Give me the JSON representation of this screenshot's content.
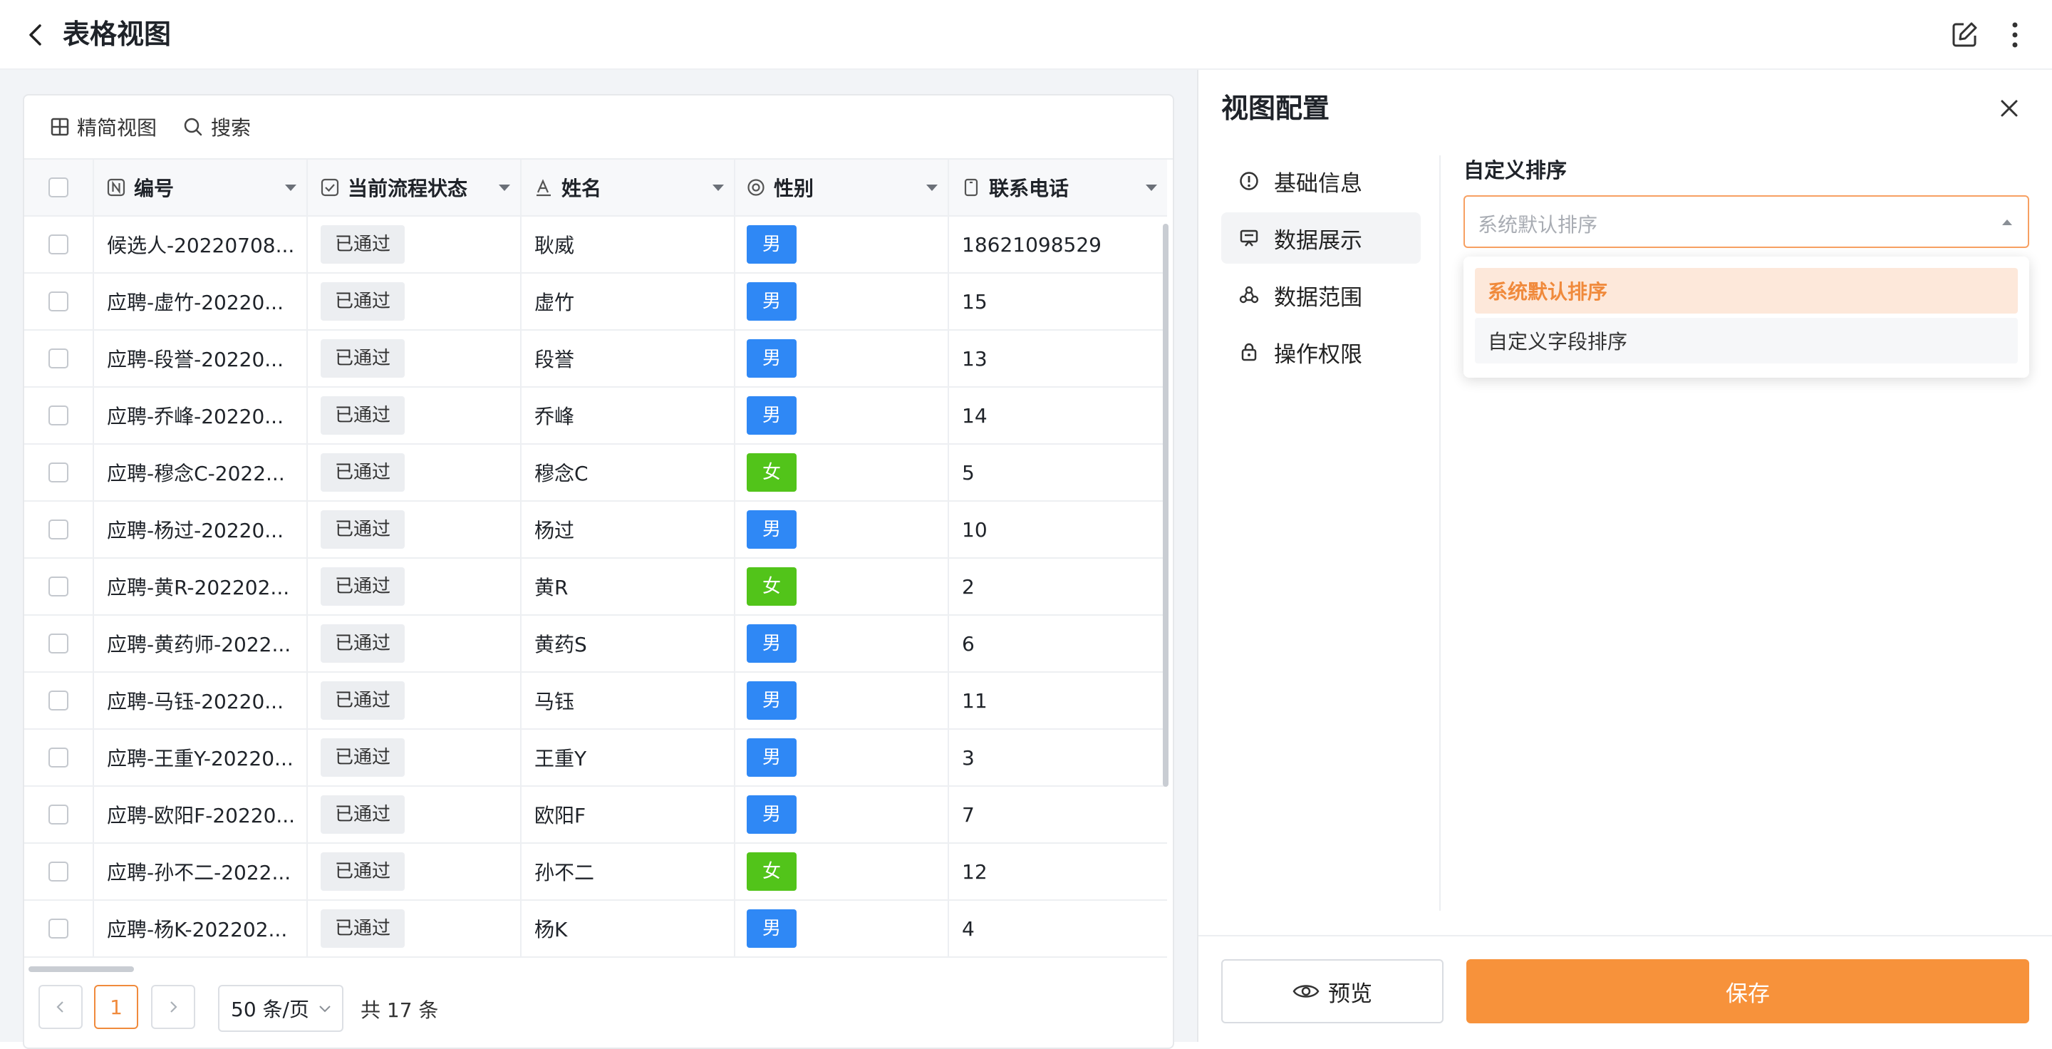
{
  "header": {
    "title": "表格视图"
  },
  "toolbar": {
    "compact_view_label": "精简视图",
    "search_label": "搜索"
  },
  "table": {
    "columns": [
      "编号",
      "当前流程状态",
      "姓名",
      "性别",
      "联系电话"
    ],
    "rows": [
      {
        "id": "候选人-20220708...",
        "status": "已通过",
        "name": "耿威",
        "gender": "男",
        "phone": "18621098529"
      },
      {
        "id": "应聘-虚竹-20220...",
        "status": "已通过",
        "name": "虚竹",
        "gender": "男",
        "phone": "15"
      },
      {
        "id": "应聘-段誉-20220...",
        "status": "已通过",
        "name": "段誉",
        "gender": "男",
        "phone": "13"
      },
      {
        "id": "应聘-乔峰-20220...",
        "status": "已通过",
        "name": "乔峰",
        "gender": "男",
        "phone": "14"
      },
      {
        "id": "应聘-穆念C-2022...",
        "status": "已通过",
        "name": "穆念C",
        "gender": "女",
        "phone": "5"
      },
      {
        "id": "应聘-杨过-20220...",
        "status": "已通过",
        "name": "杨过",
        "gender": "男",
        "phone": "10"
      },
      {
        "id": "应聘-黄R-202202...",
        "status": "已通过",
        "name": "黄R",
        "gender": "女",
        "phone": "2"
      },
      {
        "id": "应聘-黄药师-2022...",
        "status": "已通过",
        "name": "黄药S",
        "gender": "男",
        "phone": "6"
      },
      {
        "id": "应聘-马钰-20220...",
        "status": "已通过",
        "name": "马钰",
        "gender": "男",
        "phone": "11"
      },
      {
        "id": "应聘-王重Y-20220...",
        "status": "已通过",
        "name": "王重Y",
        "gender": "男",
        "phone": "3"
      },
      {
        "id": "应聘-欧阳F-20220...",
        "status": "已通过",
        "name": "欧阳F",
        "gender": "男",
        "phone": "7"
      },
      {
        "id": "应聘-孙不二-2022...",
        "status": "已通过",
        "name": "孙不二",
        "gender": "女",
        "phone": "12"
      },
      {
        "id": "应聘-杨K-202202...",
        "status": "已通过",
        "name": "杨K",
        "gender": "男",
        "phone": "4"
      }
    ]
  },
  "pagination": {
    "current_page": "1",
    "page_size": "50 条/页",
    "total": "共 17 条"
  },
  "config": {
    "title": "视图配置",
    "nav": [
      "基础信息",
      "数据展示",
      "数据范围",
      "操作权限"
    ],
    "active_nav": "数据展示",
    "sort_label": "自定义排序",
    "sort_placeholder": "系统默认排序",
    "sort_options": [
      "系统默认排序",
      "自定义字段排序"
    ],
    "preview_label": "预览",
    "save_label": "保存"
  },
  "colors": {
    "accent": "#f7923b",
    "male": "#2f88f5",
    "female": "#52c41a"
  },
  "icons": [
    "back-icon",
    "edit-icon",
    "more-icon",
    "grid-icon",
    "search-icon",
    "number-field-icon",
    "checkbox-field-icon",
    "text-field-icon",
    "radio-field-icon",
    "phone-field-icon",
    "info-icon",
    "display-icon",
    "scope-icon",
    "lock-icon",
    "close-icon",
    "eye-icon",
    "pointer-cursor-icon"
  ]
}
